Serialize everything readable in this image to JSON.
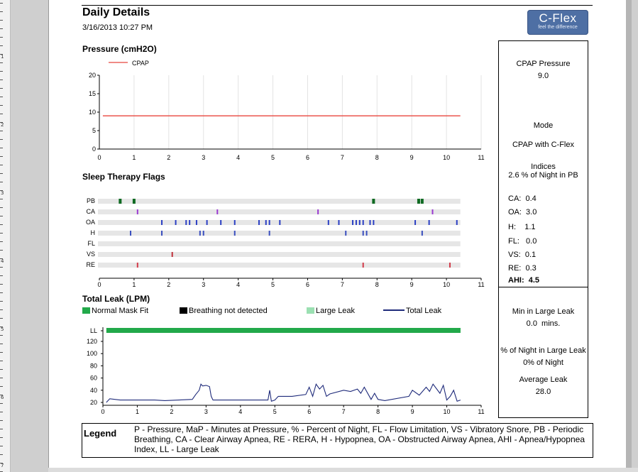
{
  "header": {
    "title": "Daily Details",
    "datetime": "3/16/2013 10:27 PM",
    "logo_text": "C-Flex",
    "logo_tagline": "feel the difference"
  },
  "colors": {
    "cpap_line": "#e8463e",
    "pb": "#0f6a22",
    "ca": "#9b3ad1",
    "oa": "#2b3fc4",
    "h": "#3a4fbf",
    "vs": "#c0303a",
    "re": "#d23b4a",
    "normal_mask_fit": "#22a94a",
    "breathing_not_detected": "#000000",
    "large_leak": "#9be0b2",
    "total_leak": "#1e2a7a"
  },
  "pressure": {
    "title": "Pressure (cmH2O)",
    "legend_label": "CPAP",
    "x_ticks": [
      "0",
      "1",
      "2",
      "3",
      "4",
      "5",
      "6",
      "7",
      "8",
      "9",
      "10",
      "11"
    ],
    "y_ticks": [
      "0",
      "5",
      "10",
      "15",
      "20"
    ]
  },
  "flags": {
    "title": "Sleep Therapy Flags",
    "rows": [
      "PB",
      "CA",
      "OA",
      "H",
      "FL",
      "VS",
      "RE"
    ],
    "x_ticks": [
      "0",
      "1",
      "2",
      "3",
      "4",
      "5",
      "6",
      "7",
      "8",
      "9",
      "10",
      "11"
    ]
  },
  "leak": {
    "title": "Total Leak (LPM)",
    "legend": {
      "normal": "Normal Mask Fit",
      "not_detected": "Breathing not detected",
      "large": "Large Leak",
      "total": "Total Leak"
    },
    "y_ticks": [
      "LL",
      "120",
      "100",
      "80",
      "60",
      "40",
      "20"
    ],
    "x_ticks": [
      "0",
      "1",
      "2",
      "3",
      "4",
      "5",
      "6",
      "7",
      "8",
      "9",
      "10",
      "11"
    ]
  },
  "side_pressure": {
    "label": "CPAP Pressure",
    "value": "9.0",
    "mode_label": "Mode",
    "mode_value": "CPAP with C-Flex"
  },
  "side_indices": {
    "label": "Indices",
    "pb_text": "2.6 % of Night in PB",
    "ca": "CA:  0.4",
    "oa": "OA:  3.0",
    "h": "H:    1.1",
    "fl": "FL:   0.0",
    "vs": "VS:  0.1",
    "re": "RE:  0.3",
    "ahi": "AHI:  4.5"
  },
  "side_leak": {
    "min_label": "Min in Large Leak",
    "min_value": "0.0  mins.",
    "pct_label": "% of Night in Large Leak",
    "pct_value": "0% of Night",
    "avg_label": "Average Leak",
    "avg_value": "28.0"
  },
  "legend": {
    "title": "Legend",
    "text": "P - Pressure, MaP - Minutes at Pressure, % - Percent of Night, FL - Flow Limitation, VS - Vibratory Snore, PB - Periodic Breathing, CA - Clear Airway Apnea, RE - RERA, H - Hypopnea, OA - Obstructed Airway Apnea, AHI - Apnea/Hypopnea Index, LL - Large Leak"
  },
  "ruler_labels": [
    "1",
    "2",
    "3",
    "4",
    "5",
    "6",
    "7"
  ],
  "chart_data": [
    {
      "type": "line",
      "title": "Pressure (cmH2O)",
      "xlim": [
        0,
        11
      ],
      "ylim": [
        0,
        20
      ],
      "grid": true,
      "legend_position": "top-left",
      "series": [
        {
          "name": "CPAP",
          "x": [
            0.1,
            10.4
          ],
          "y": [
            9.0,
            9.0
          ]
        }
      ]
    },
    {
      "type": "scatter",
      "title": "Sleep Therapy Flags",
      "xlim": [
        0,
        11
      ],
      "categories": [
        "PB",
        "CA",
        "OA",
        "H",
        "FL",
        "VS",
        "RE"
      ],
      "events": {
        "PB": [
          0.6,
          1.0,
          7.9,
          9.2,
          9.3
        ],
        "CA": [
          1.1,
          3.4,
          6.3,
          9.6
        ],
        "OA": [
          1.8,
          2.2,
          2.5,
          2.6,
          2.8,
          3.1,
          3.5,
          3.9,
          4.6,
          4.8,
          4.9,
          5.2,
          6.6,
          6.9,
          7.3,
          7.4,
          7.5,
          7.6,
          7.8,
          7.9,
          9.1,
          9.5,
          10.3
        ],
        "H": [
          0.9,
          1.8,
          2.9,
          3.0,
          3.9,
          4.9,
          7.1,
          7.6,
          7.7,
          9.3
        ],
        "FL": [],
        "VS": [
          2.1
        ],
        "RE": [
          1.1,
          7.6,
          10.1
        ]
      }
    },
    {
      "type": "line",
      "title": "Total Leak (LPM)",
      "xlim": [
        0,
        11
      ],
      "ylim": [
        0,
        130
      ],
      "grid": false,
      "legend_position": "top",
      "series": [
        {
          "name": "Total Leak",
          "x": [
            0.1,
            0.2,
            0.5,
            1.5,
            1.8,
            2.6,
            2.7,
            2.8,
            2.85,
            2.9,
            3.0,
            3.1,
            3.15,
            3.2,
            3.3,
            3.6,
            4.8,
            4.85,
            4.9,
            5.0,
            5.1,
            5.5,
            5.9,
            6.0,
            6.1,
            6.2,
            6.3,
            6.4,
            6.5,
            6.6,
            7.0,
            7.2,
            7.4,
            7.5,
            7.6,
            7.8,
            7.9,
            8.0,
            8.2,
            8.9,
            9.0,
            9.2,
            9.4,
            9.5,
            9.6,
            9.8,
            9.9,
            10.0,
            10.1,
            10.2,
            10.3,
            10.4
          ],
          "y": [
            20,
            26,
            24,
            24,
            23,
            25,
            33,
            40,
            50,
            47,
            48,
            46,
            30,
            24,
            24,
            24,
            24,
            40,
            22,
            24,
            30,
            30,
            33,
            45,
            30,
            50,
            42,
            48,
            30,
            34,
            40,
            38,
            42,
            35,
            45,
            25,
            35,
            25,
            23,
            30,
            40,
            32,
            45,
            38,
            50,
            35,
            48,
            24,
            30,
            40,
            22,
            24
          ]
        }
      ],
      "normal_mask_fit_x": [
        0.1,
        10.4
      ],
      "breathing_not_detected_x": [],
      "large_leak_x": []
    }
  ]
}
